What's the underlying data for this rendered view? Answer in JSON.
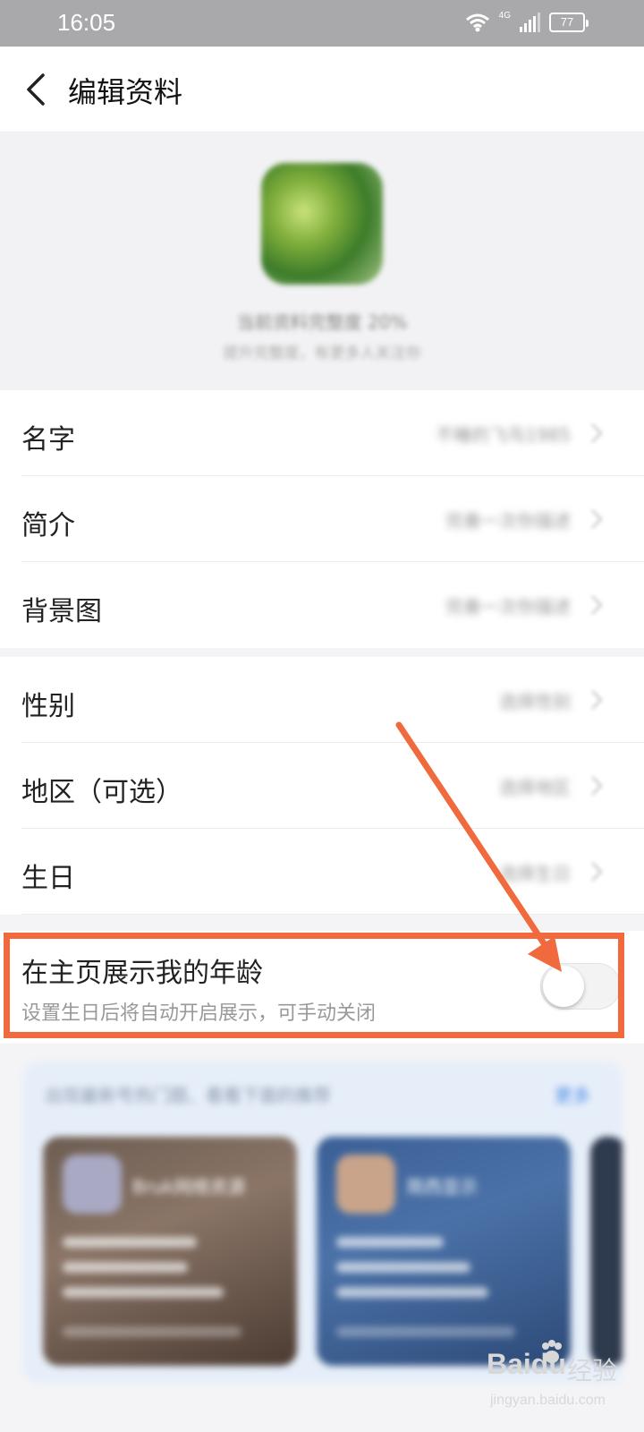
{
  "status_bar": {
    "time": "16:05",
    "network": "4G",
    "battery": "77"
  },
  "header": {
    "title": "编辑资料"
  },
  "profile": {
    "completion": "当前资料完整度 20%",
    "hint": "提升完整度，有更多人关注你"
  },
  "basic_items": [
    {
      "label": "名字",
      "value": "不睡的飞鸟1985"
    },
    {
      "label": "简介",
      "value": "完善一次你描述"
    },
    {
      "label": "背景图",
      "value": "完善一次你描述"
    }
  ],
  "detail_items": [
    {
      "label": "性别",
      "value": "选择性别"
    },
    {
      "label": "地区（可选）",
      "value": "选择地区"
    },
    {
      "label": "生日",
      "value": "选择生日"
    }
  ],
  "age_toggle": {
    "label": "在主页展示我的年龄",
    "sub": "设置生日后将自动开启展示，可手动关闭",
    "on": false
  },
  "promo": {
    "title": "出现最新号热门题、看看下面的推荐",
    "link": "更多",
    "cards": [
      {
        "name": "Bruk网络资源"
      },
      {
        "name": "简西显示"
      }
    ]
  },
  "watermark": {
    "logo": "Baidu",
    "jingyan": "经验",
    "url": "jingyan.baidu.com"
  },
  "colors": {
    "highlight": "#f06a3d",
    "toggle_off": "#f3f3f3"
  }
}
